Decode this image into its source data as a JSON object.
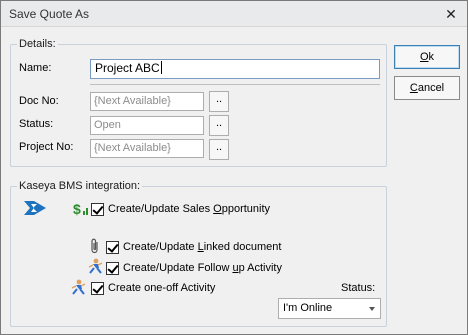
{
  "window": {
    "title": "Save Quote As",
    "close_glyph": "✕"
  },
  "details": {
    "legend": "Details:",
    "name_label": "Name:",
    "name_value": "Project ABC",
    "docno_label": "Doc No:",
    "docno_value": "{Next Available}",
    "status_label": "Status:",
    "status_value": "Open",
    "projectno_label": "Project No:",
    "projectno_value": "{Next Available}",
    "browse_label": ".."
  },
  "buttons": {
    "ok_label_pre": "",
    "ok_label_acc": "O",
    "ok_label_post": "k",
    "cancel_label_pre": "",
    "cancel_label_acc": "C",
    "cancel_label_post": "ancel"
  },
  "bms": {
    "legend": "Kaseya BMS integration:",
    "opportunity_pre": "Create/Update Sales ",
    "opportunity_acc": "O",
    "opportunity_post": "pportunity",
    "opportunity_checked": true,
    "linked_pre": "Create/Update ",
    "linked_acc": "L",
    "linked_post": "inked document",
    "linked_checked": true,
    "followup_pre": "Create/Update Follow ",
    "followup_acc": "u",
    "followup_post": "p Activity",
    "followup_checked": true,
    "oneoff_pre": "Create one-off Activity",
    "oneoff_checked": true,
    "status_label": "Status:",
    "status_value": "I'm Online"
  },
  "icons": {
    "close": "close-icon",
    "kaseya": "kaseya-logo-icon",
    "opportunity": "dollar-chart-icon",
    "linked": "paperclip-icon",
    "followup": "person-run-icon",
    "oneoff": "person-run-icon"
  },
  "colors": {
    "accent_blue": "#3c7fb1",
    "kaseya_blue": "#1e73be",
    "dollar_green": "#2e8b2e"
  }
}
